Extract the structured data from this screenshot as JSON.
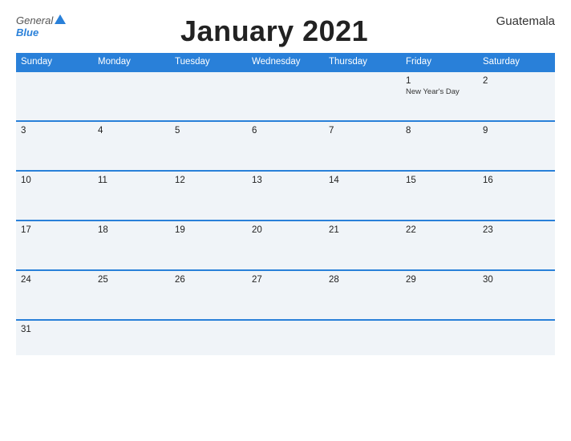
{
  "header": {
    "logo_general": "General",
    "logo_blue": "Blue",
    "title": "January 2021",
    "country": "Guatemala"
  },
  "days_of_week": [
    "Sunday",
    "Monday",
    "Tuesday",
    "Wednesday",
    "Thursday",
    "Friday",
    "Saturday"
  ],
  "weeks": [
    [
      {
        "day": "",
        "holiday": ""
      },
      {
        "day": "",
        "holiday": ""
      },
      {
        "day": "",
        "holiday": ""
      },
      {
        "day": "",
        "holiday": ""
      },
      {
        "day": "",
        "holiday": ""
      },
      {
        "day": "1",
        "holiday": "New Year's Day"
      },
      {
        "day": "2",
        "holiday": ""
      }
    ],
    [
      {
        "day": "3",
        "holiday": ""
      },
      {
        "day": "4",
        "holiday": ""
      },
      {
        "day": "5",
        "holiday": ""
      },
      {
        "day": "6",
        "holiday": ""
      },
      {
        "day": "7",
        "holiday": ""
      },
      {
        "day": "8",
        "holiday": ""
      },
      {
        "day": "9",
        "holiday": ""
      }
    ],
    [
      {
        "day": "10",
        "holiday": ""
      },
      {
        "day": "11",
        "holiday": ""
      },
      {
        "day": "12",
        "holiday": ""
      },
      {
        "day": "13",
        "holiday": ""
      },
      {
        "day": "14",
        "holiday": ""
      },
      {
        "day": "15",
        "holiday": ""
      },
      {
        "day": "16",
        "holiday": ""
      }
    ],
    [
      {
        "day": "17",
        "holiday": ""
      },
      {
        "day": "18",
        "holiday": ""
      },
      {
        "day": "19",
        "holiday": ""
      },
      {
        "day": "20",
        "holiday": ""
      },
      {
        "day": "21",
        "holiday": ""
      },
      {
        "day": "22",
        "holiday": ""
      },
      {
        "day": "23",
        "holiday": ""
      }
    ],
    [
      {
        "day": "24",
        "holiday": ""
      },
      {
        "day": "25",
        "holiday": ""
      },
      {
        "day": "26",
        "holiday": ""
      },
      {
        "day": "27",
        "holiday": ""
      },
      {
        "day": "28",
        "holiday": ""
      },
      {
        "day": "29",
        "holiday": ""
      },
      {
        "day": "30",
        "holiday": ""
      }
    ],
    [
      {
        "day": "31",
        "holiday": ""
      },
      {
        "day": "",
        "holiday": ""
      },
      {
        "day": "",
        "holiday": ""
      },
      {
        "day": "",
        "holiday": ""
      },
      {
        "day": "",
        "holiday": ""
      },
      {
        "day": "",
        "holiday": ""
      },
      {
        "day": "",
        "holiday": ""
      }
    ]
  ]
}
